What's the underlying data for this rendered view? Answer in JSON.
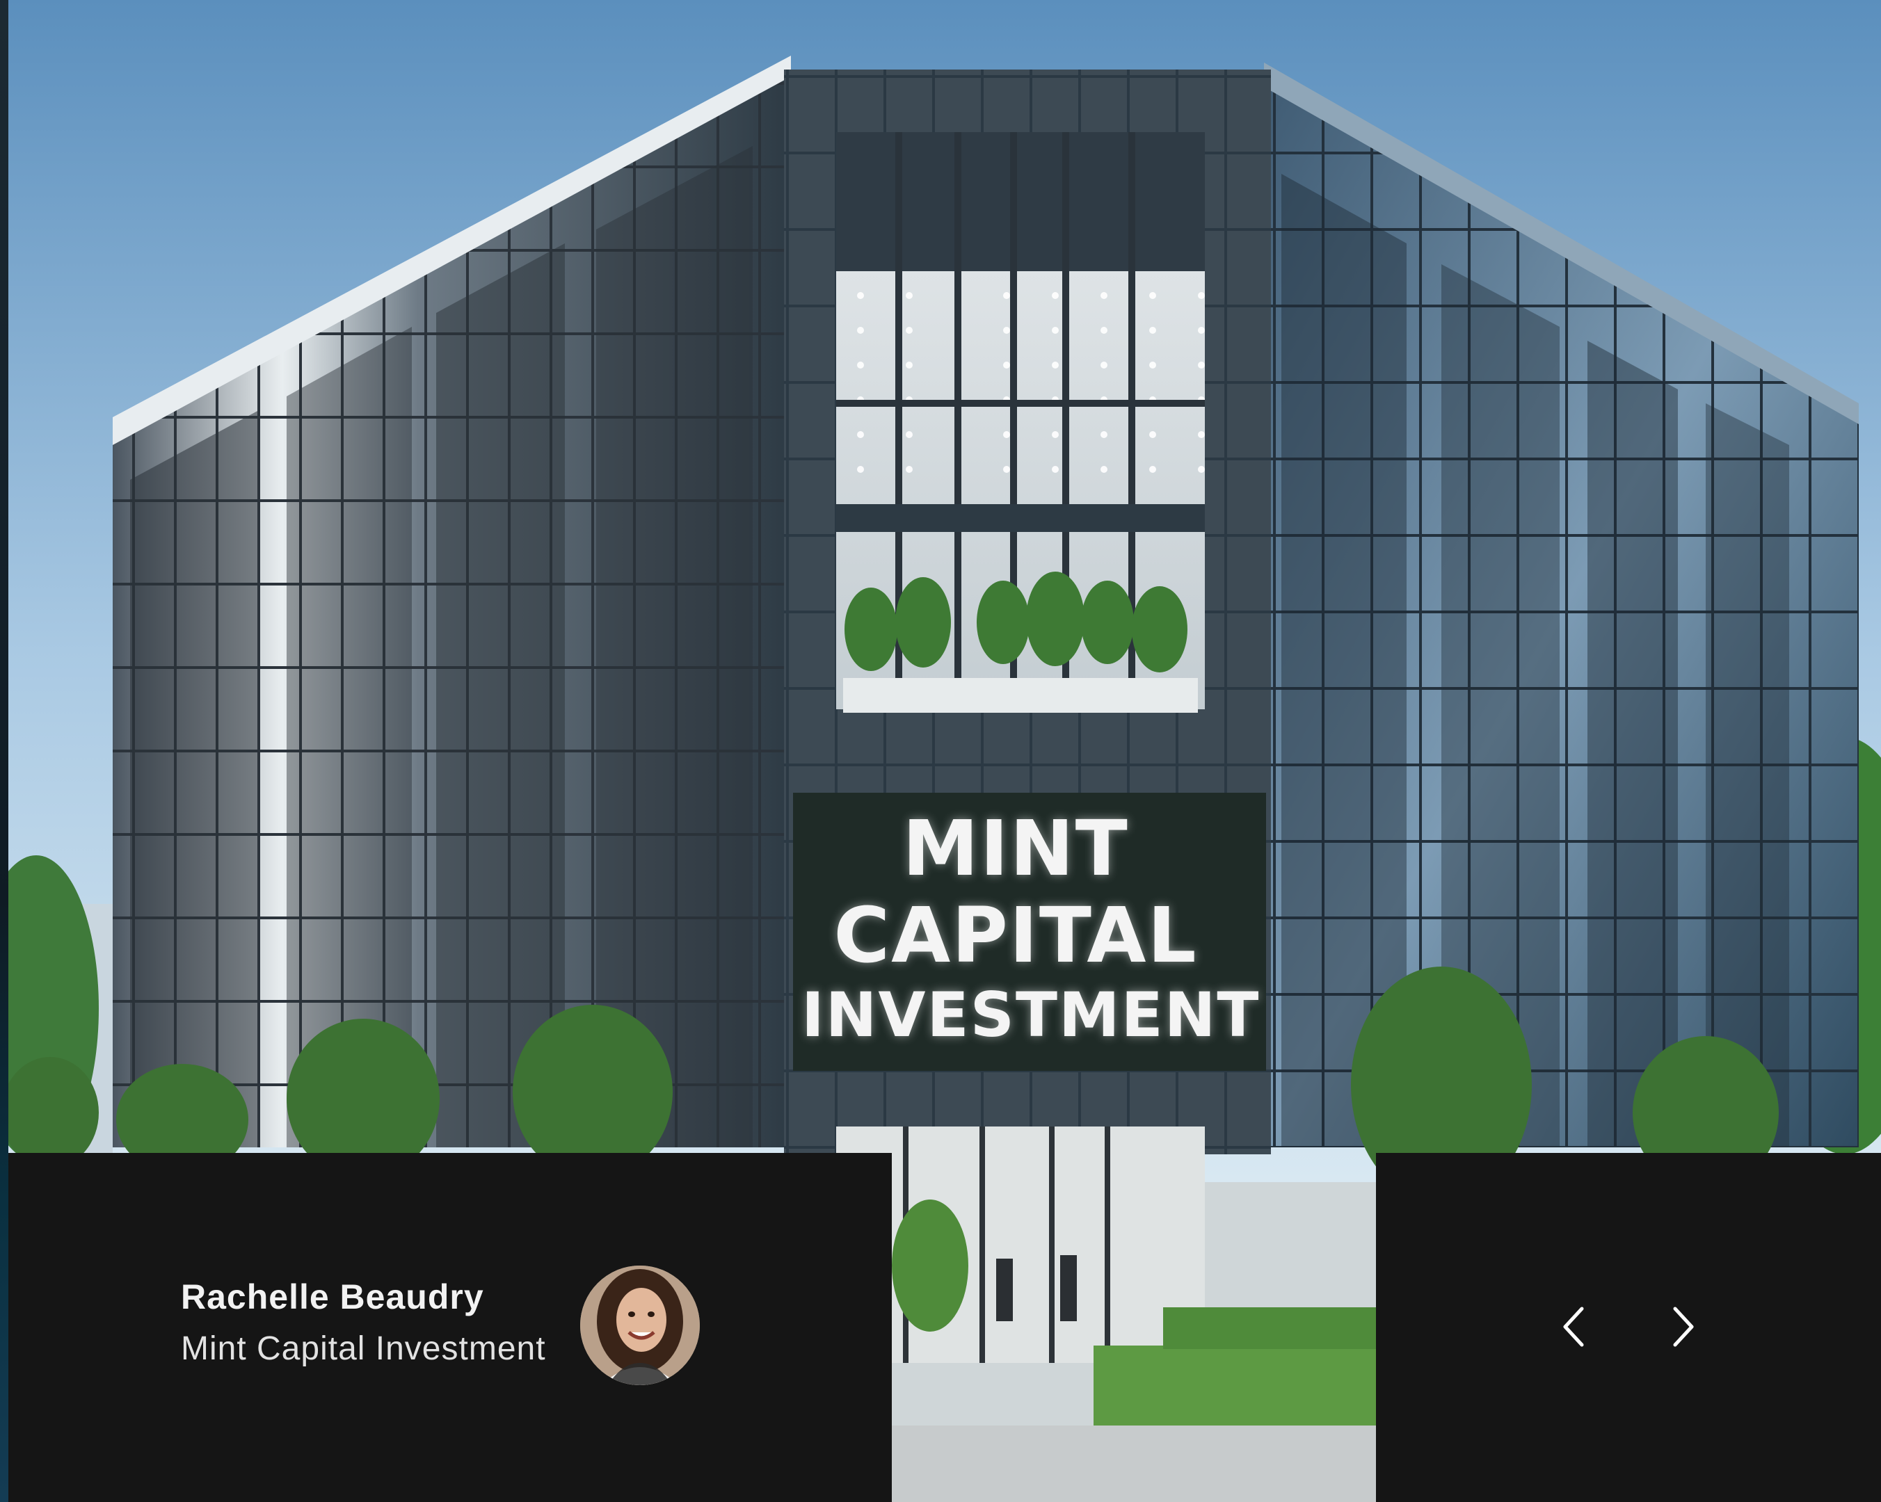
{
  "hero": {
    "image": "office-building-photo",
    "sign_lines": [
      "MINT",
      "CAPITAL",
      "INVESTMENT"
    ]
  },
  "testimonial": {
    "author_name": "Rachelle Beaudry",
    "author_company": "Mint Capital Investment",
    "avatar": "woman-portrait"
  },
  "navigation": {
    "prev_icon": "chevron-left-icon",
    "next_icon": "chevron-right-icon"
  },
  "colors": {
    "panel_bg": "#151515",
    "text_primary": "#f2f2f2",
    "sky_top": "#5b8fbd",
    "sky_bottom": "#d8e8f2"
  }
}
